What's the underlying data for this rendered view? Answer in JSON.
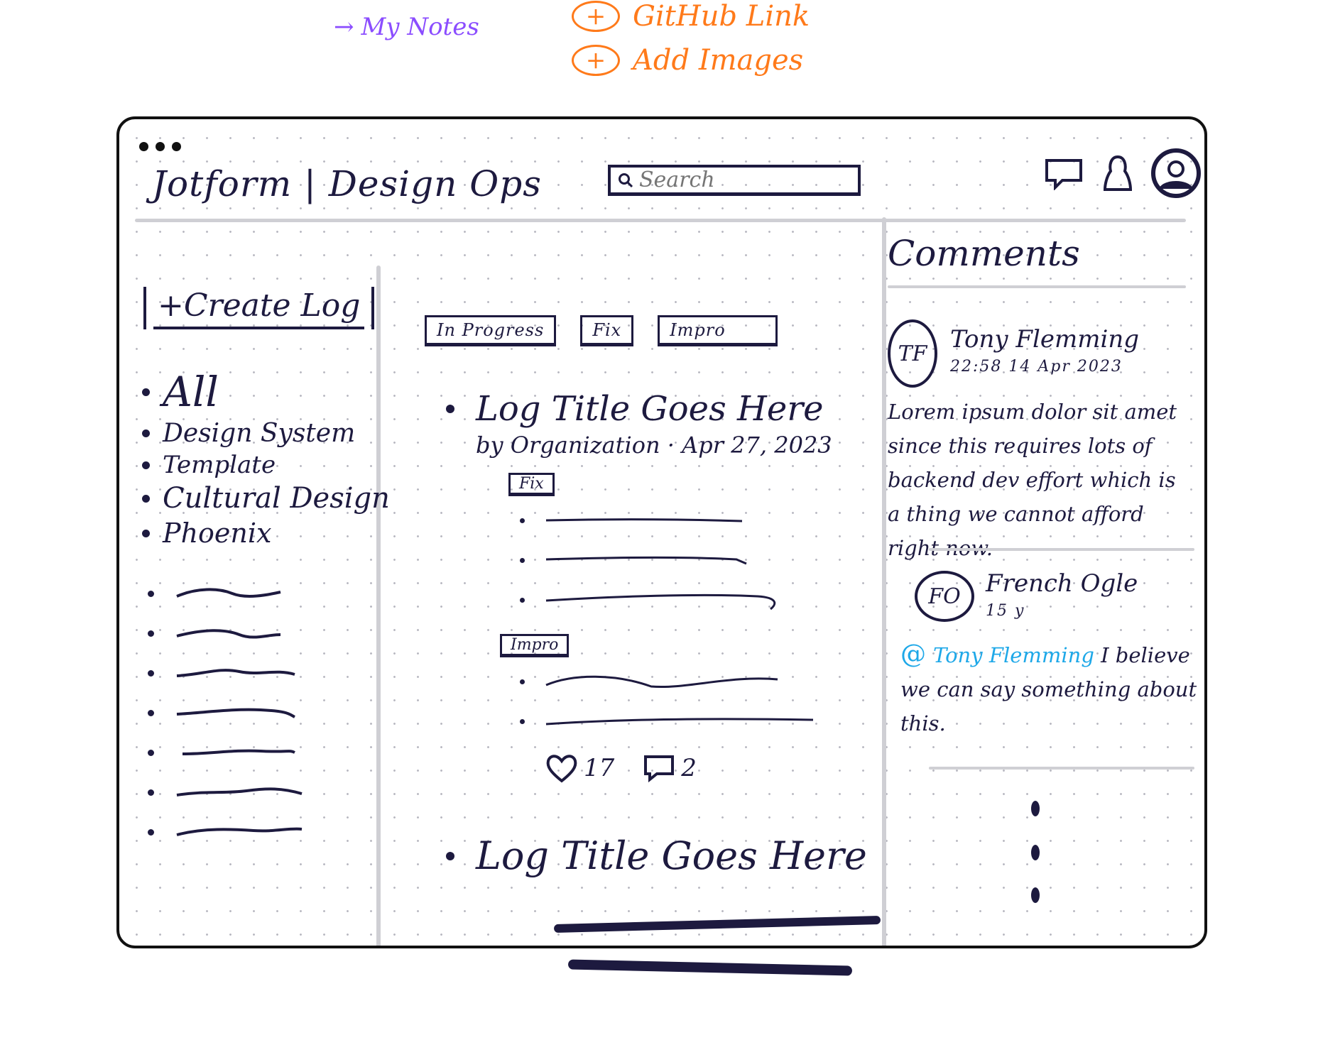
{
  "annotations": {
    "purple_note": "My Notes",
    "orange_notes": [
      "GitHub Link",
      "Add Images"
    ]
  },
  "header": {
    "title": "Jotform | Design Ops",
    "search": {
      "placeholder": "Search"
    }
  },
  "sidebar": {
    "create_label": "+Create Log",
    "categories": [
      "All",
      "Design System",
      "Template",
      "Cultural Design",
      "Phoenix"
    ]
  },
  "tabs": [
    "In Progress",
    "Fix",
    "Impro"
  ],
  "logs": [
    {
      "title": "Log Title Goes Here",
      "meta": "by Organization · Apr 27, 2023",
      "sections": [
        "Fix",
        "Impro"
      ],
      "likes": "17",
      "comments": "2"
    },
    {
      "title": "Log Title Goes Here"
    }
  ],
  "comments": {
    "title": "Comments",
    "items": [
      {
        "initials": "TF",
        "name": "Tony Flemming",
        "time": "22:58 14 Apr 2023",
        "body": "Lorem ipsum dolor sit amet since this requires lots of backend dev effort which is a thing we cannot afford right now."
      },
      {
        "initials": "FO",
        "name": "French Ogle",
        "time": "15 y",
        "mention": "Tony Flemming",
        "body": "I believe we can say something about this."
      }
    ]
  }
}
